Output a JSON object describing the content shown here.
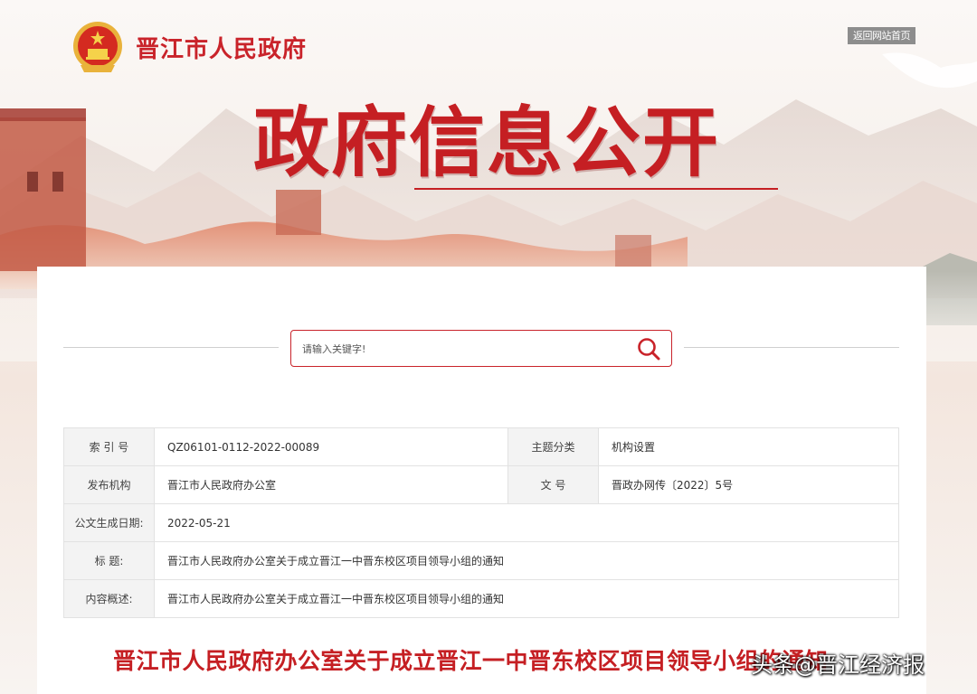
{
  "header": {
    "site_title": "晋江市人民政府",
    "home_link": "返回网站首页"
  },
  "banner": {
    "title": "政府信息公开"
  },
  "search": {
    "placeholder": "请输入关键字!"
  },
  "meta": {
    "index_label": "索 引 号",
    "index_value": "QZ06101-0112-2022-00089",
    "topic_label": "主题分类",
    "topic_value": "机构设置",
    "publisher_label": "发布机构",
    "publisher_value": "晋江市人民政府办公室",
    "docno_label": "文 号",
    "docno_value": "晋政办网传〔2022〕5号",
    "date_label": "公文生成日期:",
    "date_value": "2022-05-21",
    "title_label": "标 题:",
    "title_value": "晋江市人民政府办公室关于成立晋江一中晋东校区项目领导小组的通知",
    "summary_label": "内容概述:",
    "summary_value": "晋江市人民政府办公室关于成立晋江一中晋东校区项目领导小组的通知"
  },
  "document": {
    "title": "晋江市人民政府办公室关于成立晋江一中晋东校区项目领导小组的通知"
  },
  "watermark": "头条@晋江经济报",
  "colors": {
    "brand_red": "#c51f23",
    "table_label_bg": "#f3f3f3"
  }
}
